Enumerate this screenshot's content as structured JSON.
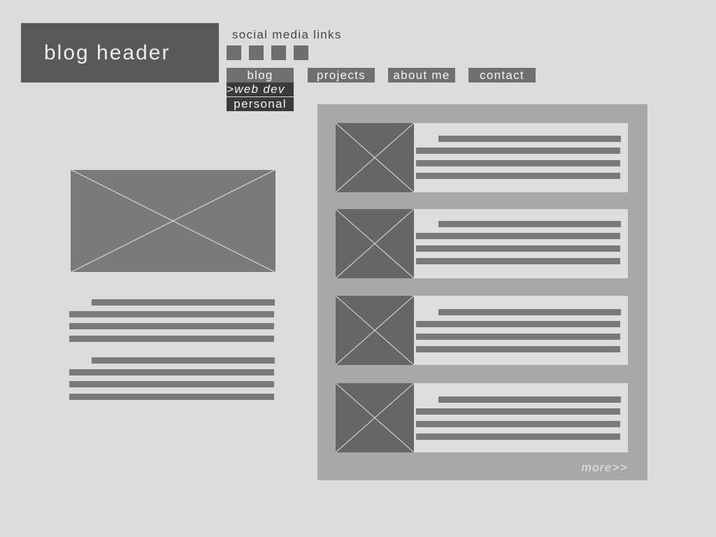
{
  "header": {
    "title": "blog header"
  },
  "social": {
    "label": "social media links",
    "icon_count": 4
  },
  "nav": {
    "items": [
      {
        "label": "blog"
      },
      {
        "label": "projects"
      },
      {
        "label": "about me"
      },
      {
        "label": "contact"
      }
    ],
    "submenu": [
      {
        "label": ">web dev"
      },
      {
        "label": "personal"
      }
    ]
  },
  "sidebar": {
    "more_label": "more>>"
  },
  "colors": {
    "background": "#dcdcdc",
    "header_block": "#595959",
    "nav_item": "#707070",
    "submenu_item": "#3a3a3a",
    "panel": "#a8a8a8",
    "placeholder": "#666666"
  }
}
